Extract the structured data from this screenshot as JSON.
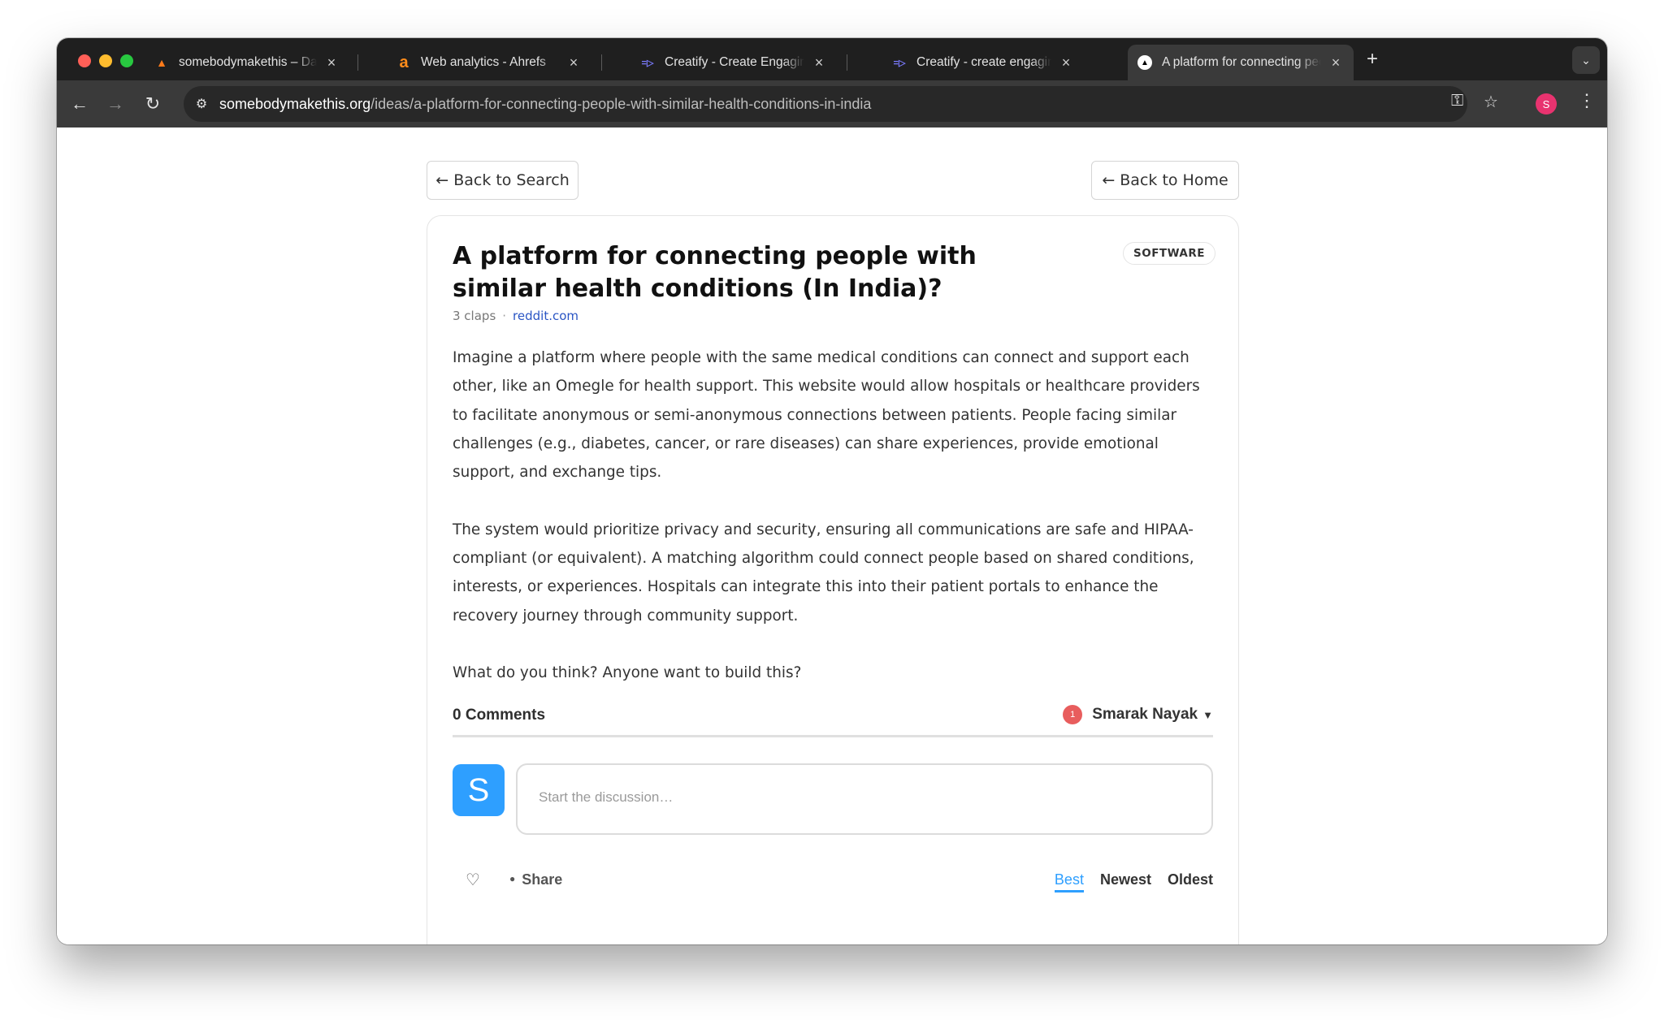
{
  "browser": {
    "tabs": [
      {
        "title": "somebodymakethis – Databa",
        "icon": "flame-icon"
      },
      {
        "title": "Web analytics - Ahrefs",
        "icon": "ahrefs-icon"
      },
      {
        "title": "Creatify - Create Engaging AI",
        "icon": "creatify-icon"
      },
      {
        "title": "Creatify - create engaging vid",
        "icon": "creatify-icon"
      },
      {
        "title": "A platform for connecting peo",
        "icon": "triangle-icon",
        "active": true
      }
    ],
    "url_host": "somebodymakethis.org",
    "url_path": "/ideas/a-platform-for-connecting-people-with-similar-health-conditions-in-india",
    "profile_initial": "S"
  },
  "nav": {
    "back_search": "← Back to Search",
    "back_home": "← Back to Home"
  },
  "idea": {
    "title": "A platform for connecting people with similar health conditions (In India)?",
    "category": "SOFTWARE",
    "claps": "3 claps",
    "separator": "·",
    "source": "reddit.com",
    "paragraphs": [
      "Imagine a platform where people with the same medical conditions can connect and support each other, like an Omegle for health support. This website would allow hospitals or healthcare providers to facilitate anonymous or semi-anonymous connections between patients. People facing similar challenges (e.g., diabetes, cancer, or rare diseases) can share experiences, provide emotional support, and exchange tips.",
      "The system would prioritize privacy and security, ensuring all communications are safe and HIPAA-compliant (or equivalent). A matching algorithm could connect people based on shared conditions, interests, or experiences. Hospitals can integrate this into their patient portals to enhance the recovery journey through community support.",
      "What do you think? Anyone want to build this?"
    ]
  },
  "comments": {
    "count_label": "0 Comments",
    "notification_count": "1",
    "user_name": "Smarak Nayak",
    "avatar_initial": "S",
    "placeholder": "Start the discussion…",
    "share_label": "Share",
    "sort_options": [
      "Best",
      "Newest",
      "Oldest"
    ],
    "accent": "#2e9fff"
  }
}
